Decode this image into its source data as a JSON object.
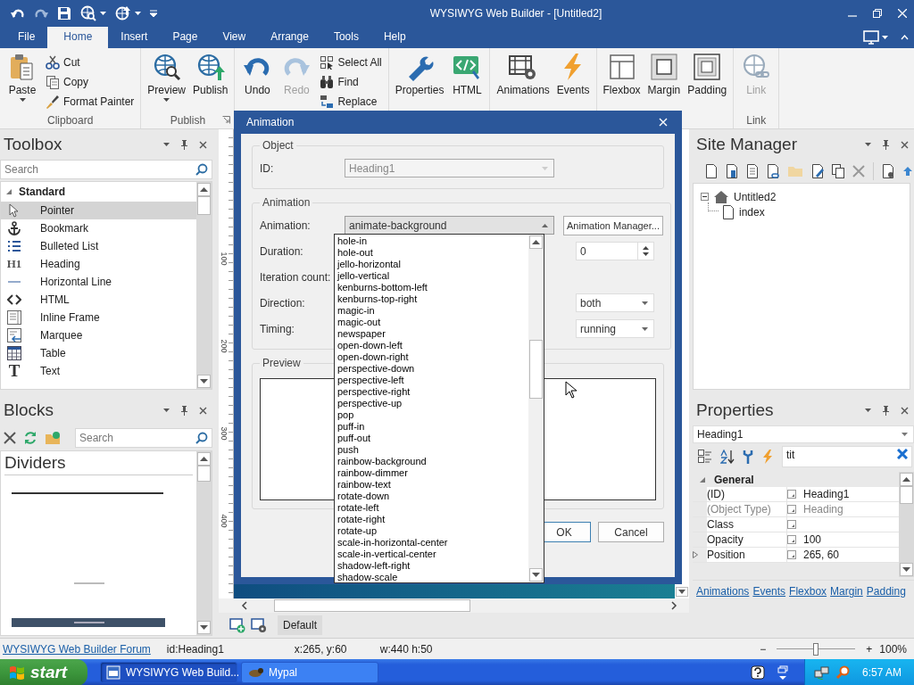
{
  "window": {
    "title": "WYSIWYG Web Builder - [Untitled2]"
  },
  "menu_tabs": [
    {
      "label": "File",
      "selected": false
    },
    {
      "label": "Home",
      "selected": true
    },
    {
      "label": "Insert",
      "selected": false
    },
    {
      "label": "Page",
      "selected": false
    },
    {
      "label": "View",
      "selected": false
    },
    {
      "label": "Arrange",
      "selected": false
    },
    {
      "label": "Tools",
      "selected": false
    },
    {
      "label": "Help",
      "selected": false
    }
  ],
  "ribbon_groups": [
    {
      "label": "Clipboard",
      "launcher": false,
      "buttons": [
        {
          "label": "Paste",
          "kind": "large",
          "dropdown": true,
          "disabled": false
        },
        {
          "label": "Cut",
          "kind": "small",
          "dropdown": false,
          "disabled": false
        },
        {
          "label": "Copy",
          "kind": "small",
          "dropdown": false,
          "disabled": false
        },
        {
          "label": "Format Painter",
          "kind": "small",
          "dropdown": false,
          "disabled": false
        }
      ]
    },
    {
      "label": "Publish",
      "launcher": true,
      "buttons": [
        {
          "label": "Preview",
          "kind": "large",
          "dropdown": true,
          "disabled": false
        },
        {
          "label": "Publish",
          "kind": "large",
          "dropdown": false,
          "disabled": false
        }
      ]
    },
    {
      "launcher": false,
      "buttons": [
        {
          "label": "Undo",
          "kind": "large",
          "dropdown": false,
          "disabled": false
        },
        {
          "label": "Redo",
          "kind": "large",
          "dropdown": false,
          "disabled": true
        },
        {
          "label": "Select All",
          "kind": "small",
          "dropdown": false,
          "disabled": false
        },
        {
          "label": "Find",
          "kind": "small",
          "dropdown": false,
          "disabled": false
        },
        {
          "label": "Replace",
          "kind": "small",
          "dropdown": false,
          "disabled": false
        }
      ]
    },
    {
      "launcher": false,
      "buttons": [
        {
          "label": "Properties",
          "kind": "large",
          "dropdown": false,
          "disabled": false
        },
        {
          "label": "HTML",
          "kind": "large",
          "dropdown": false,
          "disabled": false
        }
      ]
    },
    {
      "launcher": false,
      "buttons": [
        {
          "label": "Animations",
          "kind": "large",
          "dropdown": false,
          "disabled": false
        },
        {
          "label": "Events",
          "kind": "large",
          "dropdown": false,
          "disabled": false
        }
      ]
    },
    {
      "launcher": false,
      "buttons": [
        {
          "label": "Flexbox",
          "kind": "large",
          "dropdown": false,
          "disabled": false
        },
        {
          "label": "Margin",
          "kind": "large",
          "dropdown": false,
          "disabled": false
        },
        {
          "label": "Padding",
          "kind": "large",
          "dropdown": false,
          "disabled": false
        }
      ]
    },
    {
      "label": "Link",
      "launcher": false,
      "buttons": [
        {
          "label": "Link",
          "kind": "large",
          "dropdown": false,
          "disabled": true
        }
      ]
    }
  ],
  "toolbox": {
    "title": "Toolbox",
    "search_placeholder": "Search",
    "category": {
      "label": "Standard",
      "expanded": true
    },
    "items": [
      {
        "label": "Pointer",
        "selected": true
      },
      {
        "label": "Bookmark",
        "selected": false
      },
      {
        "label": "Bulleted List",
        "selected": false
      },
      {
        "label": "Heading",
        "selected": false,
        "icon_text": "H1"
      },
      {
        "label": "Horizontal Line",
        "selected": false
      },
      {
        "label": "HTML",
        "selected": false
      },
      {
        "label": "Inline Frame",
        "selected": false
      },
      {
        "label": "Marquee",
        "selected": false
      },
      {
        "label": "Table",
        "selected": false
      },
      {
        "label": "Text",
        "selected": false,
        "icon_text": "T"
      }
    ]
  },
  "blocks": {
    "title": "Blocks",
    "search_placeholder": "Search",
    "section": "Dividers"
  },
  "design": {
    "ruler_marks": [
      "100",
      "200",
      "300",
      "400"
    ],
    "view_tab": "Default"
  },
  "site_manager": {
    "title": "Site Manager",
    "tree": [
      {
        "label": "Untitled2",
        "expanded": true,
        "children": [
          {
            "label": "index"
          }
        ]
      }
    ]
  },
  "properties": {
    "title": "Properties",
    "object": "Heading1",
    "filter": "tit",
    "category": {
      "label": "General",
      "expanded": true
    },
    "rows": [
      {
        "name": "(ID)",
        "value": "Heading1",
        "dimmed": false,
        "expandable": false
      },
      {
        "name": "(Object Type)",
        "value": "Heading",
        "dimmed": true,
        "expandable": false
      },
      {
        "name": "Class",
        "dimmed": false,
        "expandable": false
      },
      {
        "name": "Opacity",
        "value": "100",
        "dimmed": false,
        "expandable": false
      },
      {
        "name": "Position",
        "value": "265, 60",
        "dimmed": false,
        "expandable": true
      }
    ],
    "links": [
      "Animations",
      "Events",
      "Flexbox",
      "Margin",
      "Padding"
    ]
  },
  "dialog": {
    "title": "Animation",
    "object_group": {
      "title": "Object",
      "id_label": "ID:",
      "id_value": "Heading1"
    },
    "animation_group": {
      "title": "Animation",
      "manager_button": "Animation Manager...",
      "fields": [
        {
          "label": "Animation:",
          "kind": "dropdown",
          "value": "animate-background",
          "expanded": true
        },
        {
          "label": "Duration:",
          "kind": "spin",
          "value": "0"
        },
        {
          "label": "Iteration count:",
          "kind": "label"
        },
        {
          "label": "Direction:",
          "kind": "dropdown",
          "value": "both",
          "expanded": false
        },
        {
          "label": "Timing:",
          "kind": "dropdown",
          "value": "running",
          "expanded": false
        }
      ]
    },
    "preview_group": {
      "title": "Preview"
    },
    "buttons": [
      {
        "label": "OK",
        "default": true
      },
      {
        "label": "Cancel",
        "default": false
      }
    ],
    "dropdown_list": [
      "hole-in",
      "hole-out",
      "jello-horizontal",
      "jello-vertical",
      "kenburns-bottom-left",
      "kenburns-top-right",
      "magic-in",
      "magic-out",
      "newspaper",
      "open-down-left",
      "open-down-right",
      "perspective-down",
      "perspective-left",
      "perspective-right",
      "perspective-up",
      "pop",
      "puff-in",
      "puff-out",
      "push",
      "rainbow-background",
      "rainbow-dimmer",
      "rainbow-text",
      "rotate-down",
      "rotate-left",
      "rotate-right",
      "rotate-up",
      "scale-in-horizontal-center",
      "scale-in-vertical-center",
      "shadow-left-right",
      "shadow-scale"
    ]
  },
  "status_bar": {
    "link": "WYSIWYG Web Builder Forum",
    "items": [
      "id:Heading1",
      "x:265, y:60",
      "w:440 h:50"
    ],
    "zoom": {
      "minus": "−",
      "plus": "+",
      "level": 0.5,
      "reading": "100%"
    }
  },
  "taskbar": {
    "start": "start",
    "tasks": [
      {
        "label": "WYSIWYG Web Build...",
        "selected": true
      },
      {
        "label": "Mypal",
        "selected": false
      }
    ],
    "clock": "6:57 AM"
  }
}
